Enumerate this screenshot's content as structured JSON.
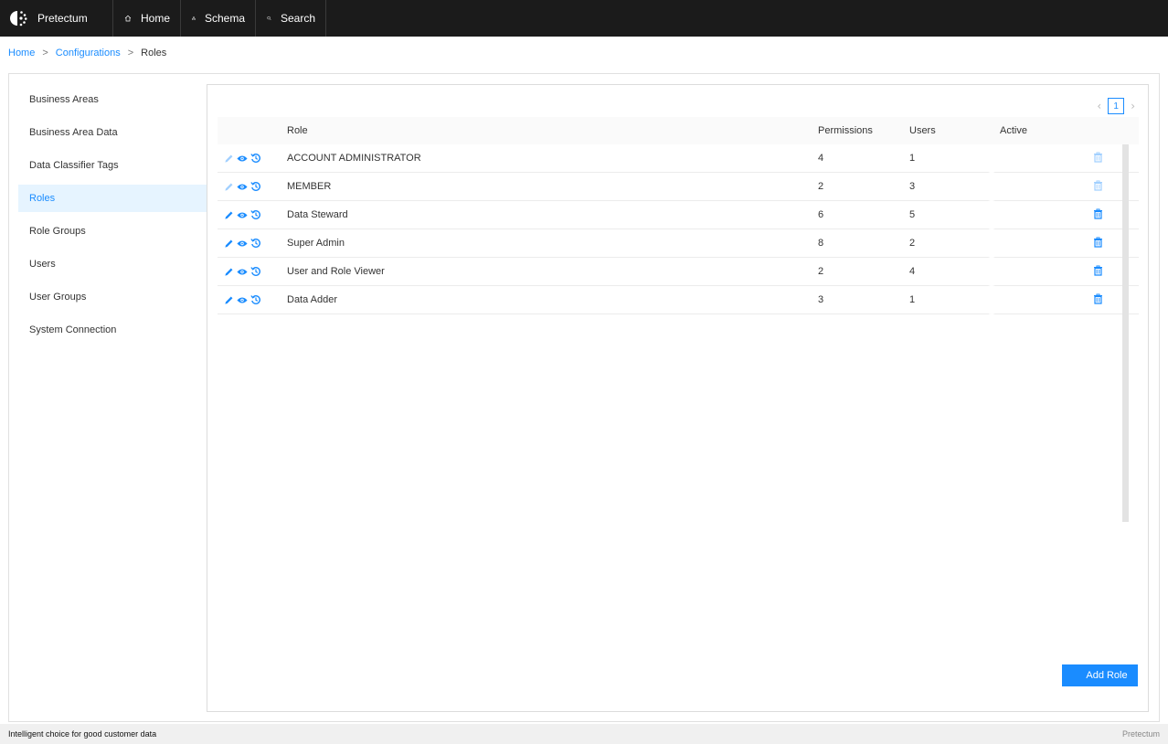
{
  "nav": {
    "brand": "Pretectum",
    "items": [
      {
        "label": "Home",
        "icon": "home-icon"
      },
      {
        "label": "Schema",
        "icon": "schema-icon"
      },
      {
        "label": "Search",
        "icon": "search-icon"
      }
    ]
  },
  "breadcrumb": {
    "home": "Home",
    "configurations": "Configurations",
    "current": "Roles",
    "separator": ">"
  },
  "sidebar": {
    "items": [
      {
        "label": "Business Areas",
        "active": false
      },
      {
        "label": "Business Area Data",
        "active": false
      },
      {
        "label": "Data Classifier Tags",
        "active": false
      },
      {
        "label": "Roles",
        "active": true
      },
      {
        "label": "Role Groups",
        "active": false
      },
      {
        "label": "Users",
        "active": false
      },
      {
        "label": "User Groups",
        "active": false
      },
      {
        "label": "System Connection",
        "active": false
      }
    ]
  },
  "pagination": {
    "current_page": "1",
    "prev_icon": "chevron-left-icon",
    "next_icon": "chevron-right-icon"
  },
  "table": {
    "columns": {
      "role": "Role",
      "permissions": "Permissions",
      "users": "Users",
      "active": "Active"
    },
    "rows": [
      {
        "role": "ACCOUNT ADMINISTRATOR",
        "permissions": "4",
        "users": "1",
        "active": true,
        "editable": false
      },
      {
        "role": "MEMBER",
        "permissions": "2",
        "users": "3",
        "active": true,
        "editable": false
      },
      {
        "role": "Data Steward",
        "permissions": "6",
        "users": "5",
        "active": true,
        "editable": true
      },
      {
        "role": "Super Admin",
        "permissions": "8",
        "users": "2",
        "active": true,
        "editable": true
      },
      {
        "role": "User and Role Viewer",
        "permissions": "2",
        "users": "4",
        "active": true,
        "editable": true
      },
      {
        "role": "Data Adder",
        "permissions": "3",
        "users": "1",
        "active": true,
        "editable": true
      }
    ]
  },
  "actions": {
    "add_role": "Add Role"
  },
  "footer": {
    "tagline": "Intelligent choice for good customer data",
    "brand": "Pretectum"
  },
  "colors": {
    "accent": "#1a8cff",
    "topbar": "#1b1b1b",
    "active_bg": "#e6f4ff"
  }
}
